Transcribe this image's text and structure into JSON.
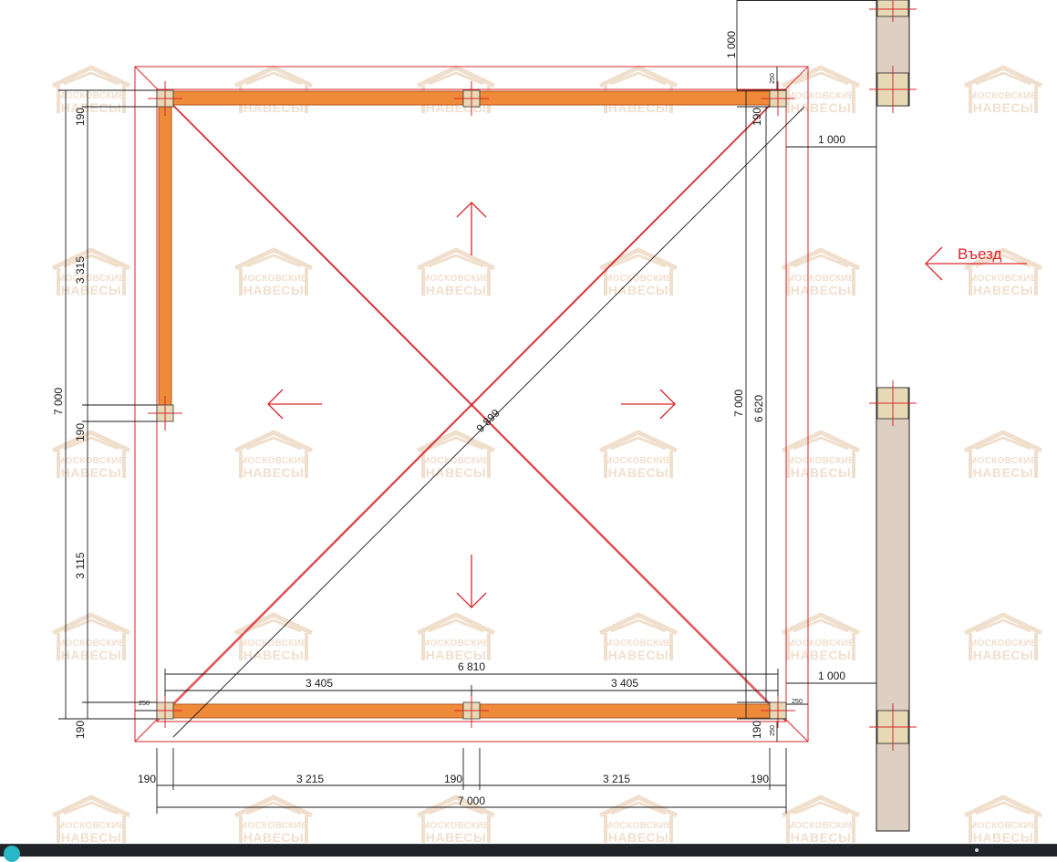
{
  "plan": {
    "entrance_label": "Въезд",
    "watermark": {
      "line1": "МОСКОВСКИЕ",
      "line2": "НАВЕСЫ"
    },
    "dimensions": {
      "top_offset": "1 000",
      "right_offset_top": "1 000",
      "right_offset_bottom": "1 000",
      "diagonal": "9 899",
      "left_overall": "7 000",
      "left_upper_span": "3 315",
      "left_lower_span": "3 115",
      "left_post_top": "190",
      "left_post_mid": "190",
      "left_post_bottom": "190",
      "right_overall": "7 000",
      "right_inner": "6 620",
      "right_post_top": "190",
      "right_post_bottom": "190",
      "overhang_top": "250",
      "overhang_bottom": "250",
      "overhang_left": "250",
      "overhang_right": "250",
      "inner_length": "6 810",
      "inner_half_left": "3 405",
      "inner_half_right": "3 405",
      "bottom_post_1": "190",
      "bottom_span_1": "3 215",
      "bottom_post_2": "190",
      "bottom_span_2": "3 215",
      "bottom_post_3": "190",
      "bottom_overall": "7 000"
    }
  },
  "colors": {
    "roof_outline": "#d8262b",
    "beam_fill": "#ef8a3a",
    "beam_stroke": "#b55418",
    "post_fill": "#e8d9b6",
    "fence_fill": "#ddd0c3",
    "watermark": "#f0dcc9",
    "dimension_line": "#1a1a1a"
  }
}
